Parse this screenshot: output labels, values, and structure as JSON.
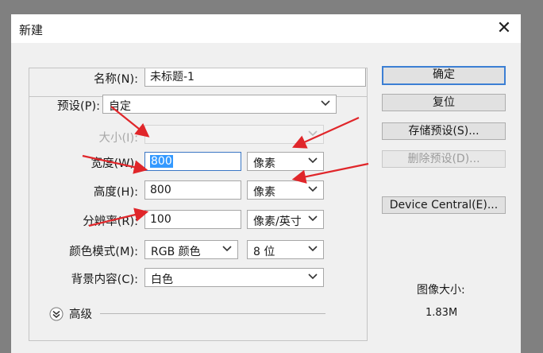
{
  "dialog": {
    "title": "新建",
    "close_glyph": "✕"
  },
  "form": {
    "name": {
      "label": "名称(N):",
      "value": "未标题-1"
    },
    "preset": {
      "label": "预设(P):",
      "value": "自定"
    },
    "size": {
      "label": "大小(I):",
      "value": ""
    },
    "width": {
      "label": "宽度(W):",
      "value": "800",
      "unit": "像素"
    },
    "height": {
      "label": "高度(H):",
      "value": "800",
      "unit": "像素"
    },
    "resolution": {
      "label": "分辨率(R):",
      "value": "100",
      "unit": "像素/英寸"
    },
    "color_mode": {
      "label": "颜色模式(M):",
      "value": "RGB 颜色",
      "depth": "8 位"
    },
    "background": {
      "label": "背景内容(C):",
      "value": "白色"
    },
    "advanced": {
      "label": "高级",
      "icon": "double-chevron-down-icon"
    }
  },
  "buttons": {
    "ok": "确定",
    "reset": "复位",
    "save_preset": "存储预设(S)...",
    "delete_preset": "删除预设(D)...",
    "device_central": "Device Central(E)..."
  },
  "info": {
    "image_size_label": "图像大小:",
    "image_size_value": "1.83M"
  },
  "colors": {
    "annotation_arrow": "#e0262a",
    "focus_border": "#3b77c5",
    "selection": "#3399ff"
  }
}
